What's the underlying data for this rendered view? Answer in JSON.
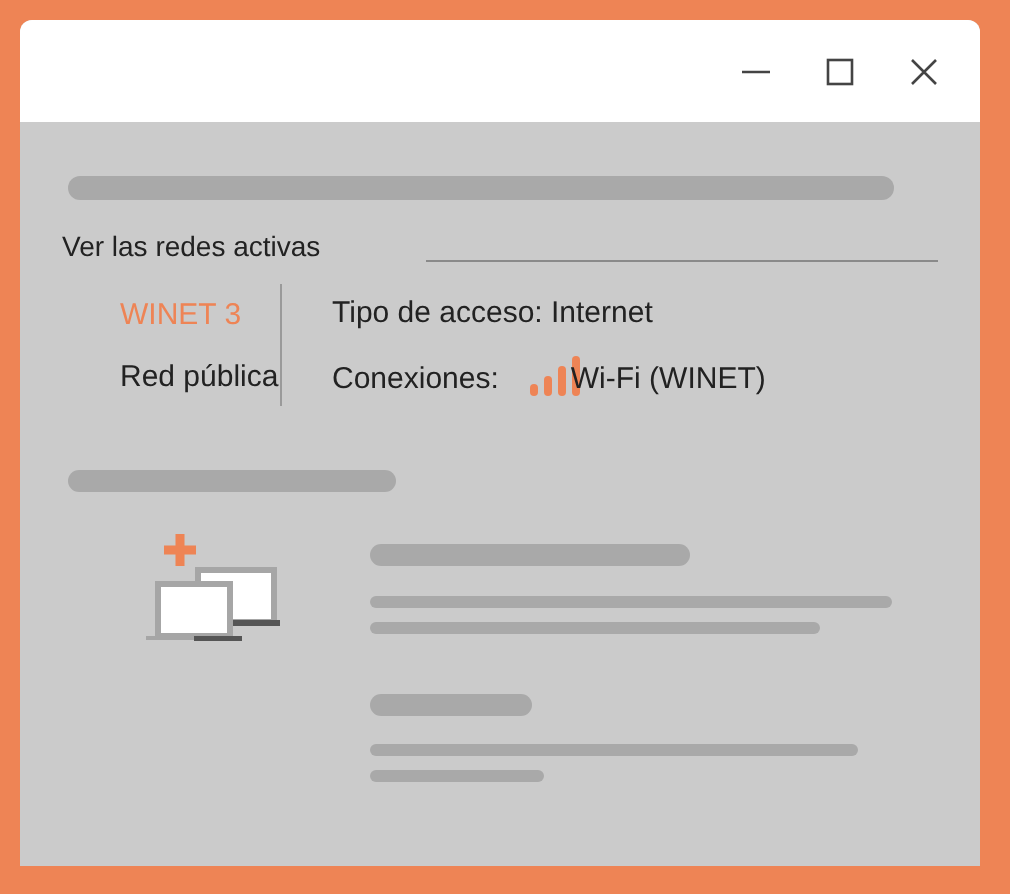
{
  "section_label": "Ver las redes activas",
  "network": {
    "name": "WINET 3",
    "category": "Red pública"
  },
  "details": {
    "access_type": "Tipo de acceso: Internet",
    "connections_label": "Conexiones:",
    "connection": "Wi-Fi (WINET)"
  }
}
